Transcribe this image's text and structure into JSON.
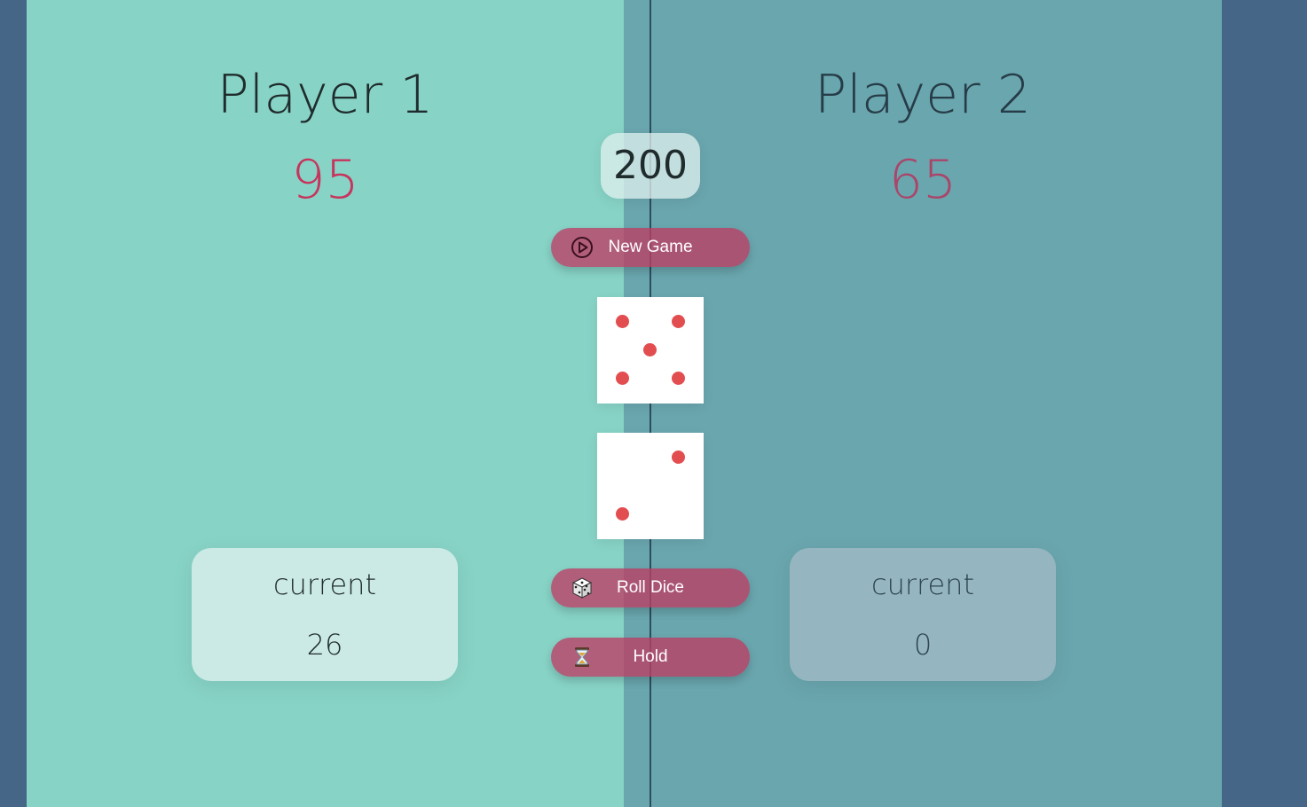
{
  "players": [
    {
      "name": "Player 1",
      "score": "95",
      "current_label": "current",
      "current_value": "26",
      "active": true
    },
    {
      "name": "Player 2",
      "score": "65",
      "current_label": "current",
      "current_value": "0",
      "active": false
    }
  ],
  "target_score": "200",
  "buttons": {
    "new_game": {
      "label": "New Game",
      "icon": "play-circle-icon"
    },
    "roll_dice": {
      "label": "Roll Dice",
      "icon": "dice-icon"
    },
    "hold": {
      "label": "Hold",
      "icon": "hourglass-icon"
    }
  },
  "dice": [
    {
      "value": 5
    },
    {
      "value": 2
    }
  ],
  "colors": {
    "active_panel": "#87d3c6",
    "inactive_panel": "#6aa6ae",
    "score_accent": "#c7345c",
    "button": "#bd3e64",
    "pip": "#e24d50"
  }
}
